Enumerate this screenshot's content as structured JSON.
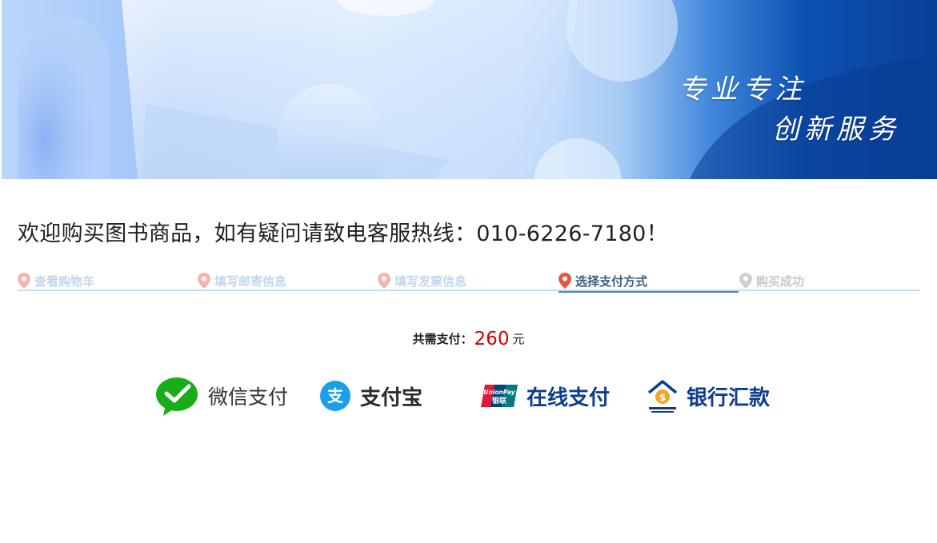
{
  "banner": {
    "slogan_line1": "专业专注",
    "slogan_line2": "创新服务"
  },
  "notice": {
    "text": "欢迎购买图书商品，如有疑问请致电客服热线：010-6226-7180！"
  },
  "steps": [
    {
      "label": "查看购物车",
      "state": "done"
    },
    {
      "label": "填写邮寄信息",
      "state": "done"
    },
    {
      "label": "填写发票信息",
      "state": "done"
    },
    {
      "label": "选择支付方式",
      "state": "current"
    },
    {
      "label": "购买成功",
      "state": "future"
    }
  ],
  "total": {
    "label": "共需支付：",
    "amount": "260",
    "unit": "元",
    "amount_color": "#d40000"
  },
  "payment_options": [
    {
      "label": "微信支付",
      "icon": "wechat-pay-icon",
      "color": "#1aad19"
    },
    {
      "label": "支付宝",
      "icon": "alipay-icon",
      "color": "#1a9fe8"
    },
    {
      "label": "在线支付",
      "icon": "unionpay-icon",
      "icon_text_top": "UnionPay",
      "icon_text_bottom": "银联",
      "color": "#0d3d8c"
    },
    {
      "label": "银行汇款",
      "icon": "bank-transfer-icon",
      "color": "#0d3d8c"
    }
  ],
  "colors": {
    "step_current": "#3b5d84",
    "step_done": "#c3d7ea",
    "step_future": "#c8c8c8",
    "pin_active": "#e8553e",
    "pin_done": "#f5b5ae"
  }
}
